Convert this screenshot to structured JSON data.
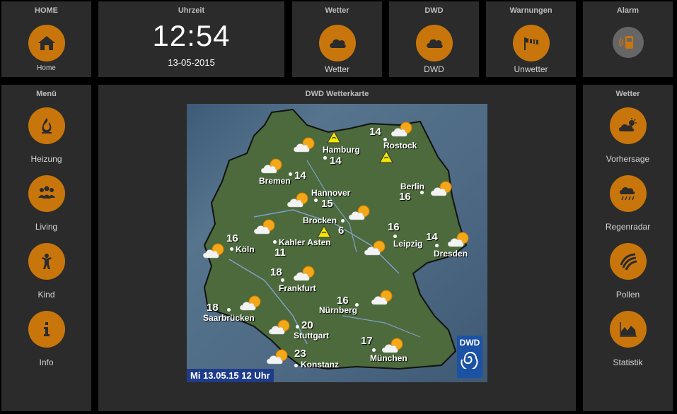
{
  "home": {
    "title": "HOME",
    "label": "Home"
  },
  "clock": {
    "title": "Uhrzeit",
    "time": "12:54",
    "date": "13-05-2015"
  },
  "wetter_top": {
    "title": "Wetter",
    "label": "Wetter"
  },
  "dwd": {
    "title": "DWD",
    "label": "DWD"
  },
  "warnungen": {
    "title": "Warnungen",
    "label": "Unwetter"
  },
  "alarm": {
    "title": "Alarm"
  },
  "menu": {
    "title": "Menü",
    "items": [
      {
        "label": "Heizung",
        "icon": "flame-icon"
      },
      {
        "label": "Living",
        "icon": "people-icon"
      },
      {
        "label": "Kind",
        "icon": "child-icon"
      },
      {
        "label": "Info",
        "icon": "info-icon"
      }
    ]
  },
  "map": {
    "title": "DWD Wetterkarte",
    "date_label": "Mi 13.05.15 12 Uhr",
    "logo_text": "DWD",
    "cities": [
      {
        "name": "Hamburg",
        "temp": "14"
      },
      {
        "name": "Rostock",
        "temp": "14"
      },
      {
        "name": "Bremen",
        "temp": "14"
      },
      {
        "name": "Hannover",
        "temp": "15"
      },
      {
        "name": "Berlin",
        "temp": "16"
      },
      {
        "name": "Brocken",
        "temp": "6"
      },
      {
        "name": "Köln",
        "temp": "16"
      },
      {
        "name": "Kahler Asten",
        "temp": "11"
      },
      {
        "name": "Leipzig",
        "temp": "16"
      },
      {
        "name": "Dresden",
        "temp": "14"
      },
      {
        "name": "Frankfurt",
        "temp": "18"
      },
      {
        "name": "Nürnberg",
        "temp": "16"
      },
      {
        "name": "Saarbrücken",
        "temp": "18"
      },
      {
        "name": "Stuttgart",
        "temp": "20"
      },
      {
        "name": "München",
        "temp": "17"
      },
      {
        "name": "Konstanz",
        "temp": "23"
      }
    ]
  },
  "wetter_right": {
    "title": "Wetter",
    "items": [
      {
        "label": "Vorhersage",
        "icon": "forecast-icon"
      },
      {
        "label": "Regenradar",
        "icon": "rain-radar-icon"
      },
      {
        "label": "Pollen",
        "icon": "pollen-icon"
      },
      {
        "label": "Statistik",
        "icon": "statistics-icon"
      }
    ]
  },
  "colors": {
    "accent": "#c8760c",
    "panel": "#2b2b2b",
    "background": "#000000"
  }
}
